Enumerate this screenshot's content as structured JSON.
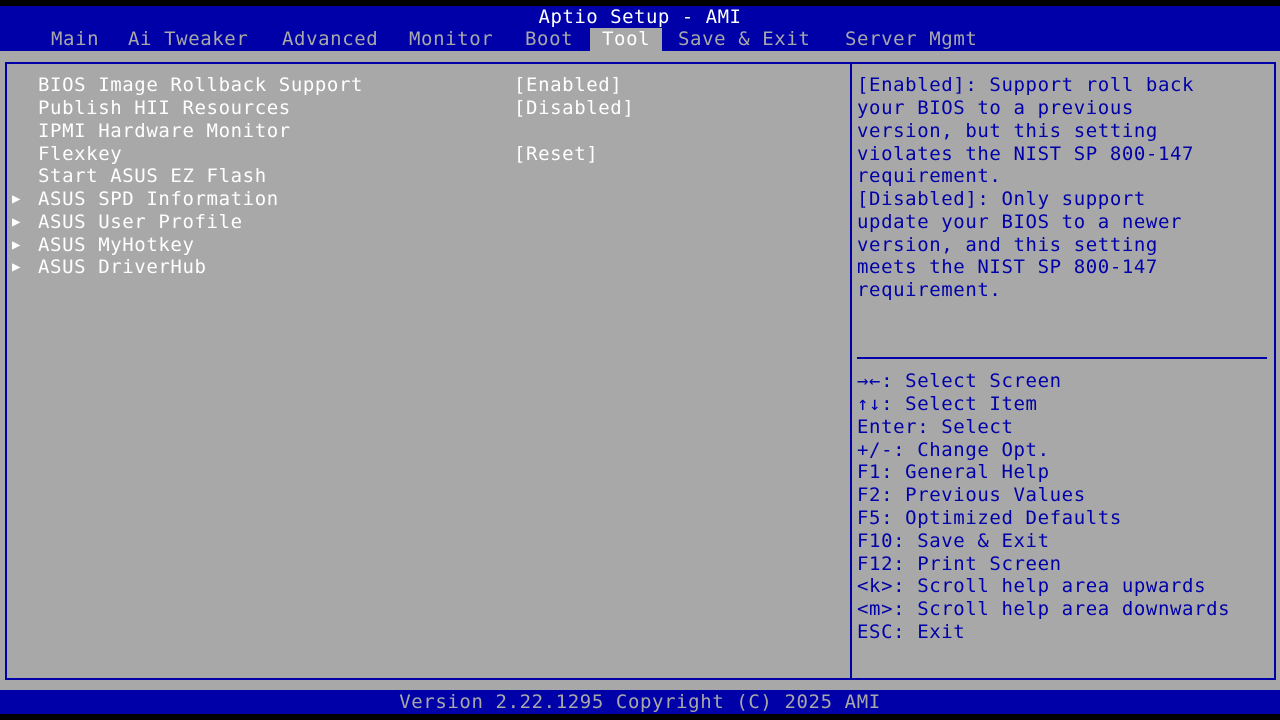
{
  "header": {
    "title": "Aptio Setup - AMI",
    "tabs": [
      {
        "label": "Main"
      },
      {
        "label": "Ai Tweaker"
      },
      {
        "label": "Advanced"
      },
      {
        "label": "Monitor"
      },
      {
        "label": "Boot"
      },
      {
        "label": "Tool",
        "active": true
      },
      {
        "label": "Save & Exit"
      },
      {
        "label": "Server Mgmt"
      }
    ]
  },
  "menu": {
    "items": [
      {
        "label": "BIOS Image Rollback Support",
        "value": "[Enabled]"
      },
      {
        "label": "Publish HII Resources",
        "value": "[Disabled]"
      },
      {
        "label": "IPMI Hardware Monitor"
      },
      {
        "label": "Flexkey",
        "value": "[Reset]"
      },
      {
        "label": "Start ASUS EZ Flash"
      },
      {
        "label": "ASUS SPD Information",
        "submenu": true
      },
      {
        "label": "ASUS User Profile",
        "submenu": true
      },
      {
        "label": "ASUS MyHotkey",
        "submenu": true
      },
      {
        "label": "ASUS DriverHub",
        "submenu": true
      }
    ],
    "submenu_arrow": "▶"
  },
  "help": {
    "lines": [
      "[Enabled]: Support roll back",
      "your BIOS to a previous",
      "version, but this setting",
      "violates the NIST SP 800-147",
      "requirement.",
      "[Disabled]: Only support",
      "update your BIOS to a newer",
      "version, and this setting",
      "meets the NIST SP 800-147",
      "requirement."
    ]
  },
  "keys": {
    "lines": [
      "→←: Select Screen",
      "↑↓: Select Item",
      "Enter: Select",
      "+/-: Change Opt.",
      "F1: General Help",
      "F2: Previous Values",
      "F5: Optimized Defaults",
      "F10: Save & Exit",
      "F12: Print Screen",
      "<k>: Scroll help area upwards",
      "<m>: Scroll help area downwards",
      "ESC: Exit"
    ]
  },
  "footer": {
    "text": "Version 2.22.1295 Copyright (C) 2025 AMI"
  },
  "colors": {
    "bios_blue": "#0000a8",
    "bios_gray": "#a8a8a8",
    "text_white": "#ffffff"
  }
}
